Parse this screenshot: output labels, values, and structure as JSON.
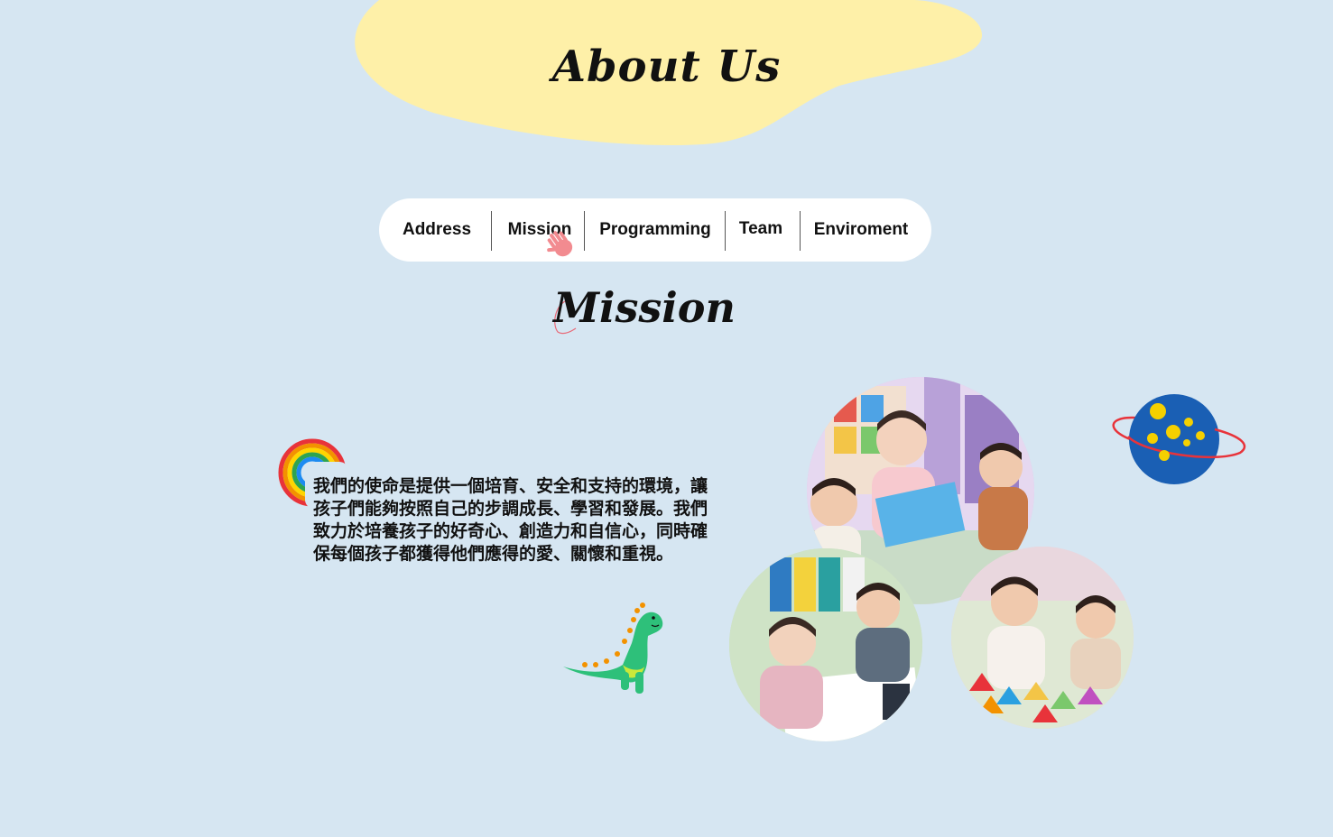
{
  "header": {
    "title": "About Us"
  },
  "tabs": [
    {
      "label": "Address"
    },
    {
      "label": "Mission"
    },
    {
      "label": "Programming"
    },
    {
      "label": "Team"
    },
    {
      "label": "Enviroment"
    }
  ],
  "mission": {
    "title": "Mission",
    "body": "我們的使命是提供一個培育、安全和支持的環境，讓孩子們能夠按照自己的步調成長、學習和發展。我們致力於培養孩子的好奇心、創造力和自信心，同時確保每個孩子都獲得他們應得的愛、關懷和重視。"
  },
  "icons": [
    "hand-print-icon",
    "rainbow-icon",
    "dinosaur-icon",
    "planet-icon",
    "squiggle-icon"
  ],
  "colors": {
    "background": "#d6e6f2",
    "header_blob": "#fef0a8",
    "tab_bar": "#ffffff",
    "hand_print": "#f28b90",
    "planet": "#1a5fb4",
    "planet_dots": "#f5d000",
    "planet_ring": "#e8333a",
    "dinosaur": "#2ec07a"
  }
}
